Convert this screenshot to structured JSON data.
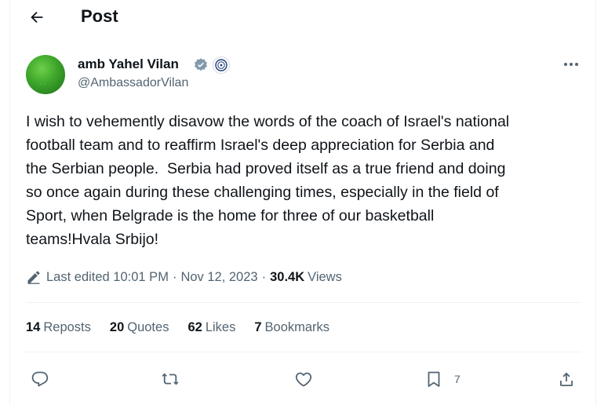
{
  "header": {
    "title": "Post"
  },
  "author": {
    "name": "amb Yahel Vilan",
    "handle": "@AmbassadorVilan"
  },
  "tweet": {
    "text": "I wish to vehemently disavow the words of the coach of Israel's national\nfootball team and to reaffirm Israel's deep appreciation for Serbia and\nthe Serbian people.  Serbia had proved itself as a true friend and doing\nso once again during these challenging times, especially in the field of\nSport, when Belgrade is the home for three of our basketball\nteams!Hvala Srbijo!"
  },
  "meta": {
    "edited_label": "Last edited 10:01 PM",
    "separator": "·",
    "date": "Nov 12, 2023",
    "views_count": "30.4K",
    "views_label": "Views"
  },
  "stats": {
    "reposts_count": "14",
    "reposts_label": "Reposts",
    "quotes_count": "20",
    "quotes_label": "Quotes",
    "likes_count": "62",
    "likes_label": "Likes",
    "bookmarks_count": "7",
    "bookmarks_label": "Bookmarks"
  },
  "actions": {
    "bookmark_count": "7"
  },
  "colors": {
    "text": "#0f1419",
    "secondary": "#536471",
    "divider": "#eff3f4",
    "verified": "#829aab"
  }
}
